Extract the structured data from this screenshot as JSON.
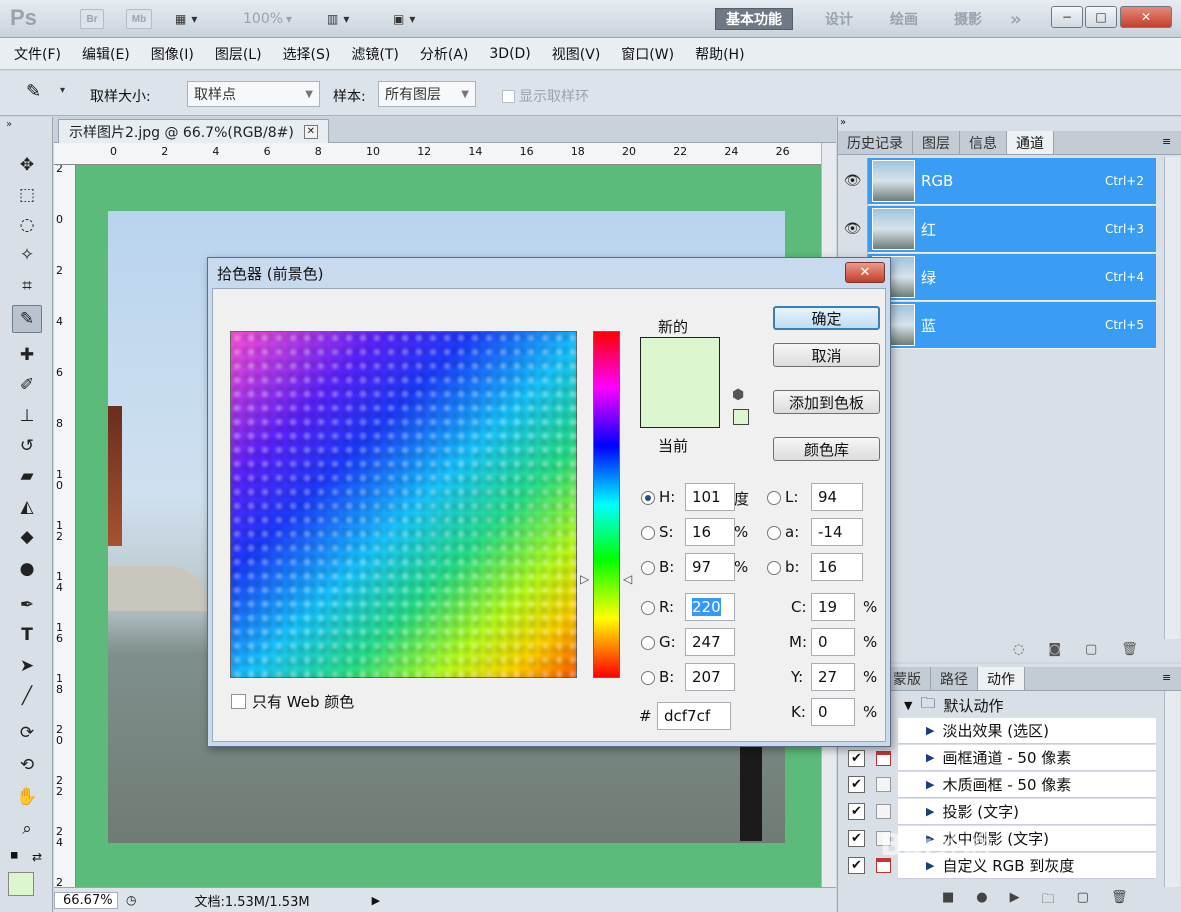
{
  "app": {
    "logo": "Ps",
    "chip_br": "Br",
    "chip_mb": "Mb",
    "zoom": "100%"
  },
  "workspaces": [
    "基本功能",
    "设计",
    "绘画",
    "摄影"
  ],
  "menu": [
    "文件(F)",
    "编辑(E)",
    "图像(I)",
    "图层(L)",
    "选择(S)",
    "滤镜(T)",
    "分析(A)",
    "3D(D)",
    "视图(V)",
    "窗口(W)",
    "帮助(H)"
  ],
  "options": {
    "sample_size_label": "取样大小:",
    "sample_size_value": "取样点",
    "sample_label": "样本:",
    "sample_value": "所有图层",
    "show_ring": "显示取样环"
  },
  "document": {
    "tab_title": "示样图片2.jpg @ 66.7%(RGB/8#)",
    "zoom": "66.67%",
    "doc_info": "文档:1.53M/1.53M",
    "ruler_h": [
      "0",
      "2",
      "4",
      "6",
      "8",
      "10",
      "12",
      "14",
      "16",
      "18",
      "20",
      "22",
      "24",
      "26"
    ],
    "ruler_v": [
      "2",
      "0",
      "2",
      "4",
      "6",
      "8",
      "1\n0",
      "1\n2",
      "1\n4",
      "1\n6",
      "1\n8",
      "2\n0",
      "2\n2",
      "2\n4",
      "2\n6",
      "2"
    ]
  },
  "panel_top": {
    "tabs": [
      "历史记录",
      "图层",
      "信息",
      "通道"
    ],
    "active_tab": "通道",
    "channels": [
      {
        "name": "RGB",
        "shortcut": "Ctrl+2"
      },
      {
        "name": "红",
        "shortcut": "Ctrl+3"
      },
      {
        "name": "绿",
        "shortcut": "Ctrl+4"
      },
      {
        "name": "蓝",
        "shortcut": "Ctrl+5"
      }
    ]
  },
  "panel_bottom": {
    "tabs": [
      "蒙版",
      "路径",
      "动作"
    ],
    "active_tab": "动作",
    "set_name": "默认动作",
    "actions": [
      "淡出效果 (选区)",
      "画框通道 - 50 像素",
      "木质画框 - 50 像素",
      "投影 (文字)",
      "水中倒影 (文字)",
      "自定义 RGB 到灰度"
    ]
  },
  "dialog": {
    "title": "拾色器 (前景色)",
    "new_label": "新的",
    "current_label": "当前",
    "new_color": "#dcf7cf",
    "current_color": "#dcf7cf",
    "buttons": {
      "ok": "确定",
      "cancel": "取消",
      "add_swatch": "添加到色板",
      "libraries": "颜色库"
    },
    "web_only": "只有 Web 颜色",
    "hsb": {
      "h": "101",
      "s": "16",
      "b": "97",
      "h_unit": "度",
      "s_unit": "%",
      "b_unit": "%"
    },
    "lab": {
      "l": "94",
      "a": "-14",
      "b": "16"
    },
    "rgb": {
      "r": "220",
      "g": "247",
      "b": "207"
    },
    "cmyk": {
      "c": "19",
      "m": "0",
      "y": "27",
      "k": "0"
    },
    "hex": "dcf7cf",
    "labels": {
      "H": "H:",
      "S": "S:",
      "B": "B:",
      "L": "L:",
      "a": "a:",
      "b": "b:",
      "R": "R:",
      "G": "G:",
      "B2": "B:",
      "C": "C:",
      "M": "M:",
      "Y": "Y:",
      "K": "K:",
      "hash": "#"
    }
  },
  "watermark": "Bai经验"
}
